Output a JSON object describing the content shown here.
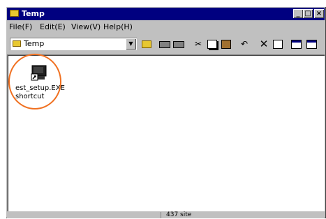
{
  "window": {
    "title": "Temp"
  },
  "menu": {
    "items": [
      {
        "label": "File(F)"
      },
      {
        "label": "Edit(E)"
      },
      {
        "label": "View(V)"
      },
      {
        "label": "Help(H)"
      }
    ]
  },
  "address": {
    "value": "Temp"
  },
  "toolbar": {
    "buttons": [
      {
        "icon": "up-folder-icon"
      },
      {
        "icon": "map-drive-icon"
      },
      {
        "icon": "disconnect-drive-icon"
      },
      {
        "icon": "cut-icon"
      },
      {
        "icon": "copy-icon"
      },
      {
        "icon": "paste-icon"
      },
      {
        "icon": "undo-icon"
      },
      {
        "icon": "delete-icon"
      },
      {
        "icon": "properties-icon"
      },
      {
        "icon": "large-icons-icon"
      },
      {
        "icon": "small-icons-icon"
      }
    ]
  },
  "files": [
    {
      "name_line1": "est_setup.EXE",
      "name_line2": "shortcut"
    }
  ],
  "status": {
    "size": "437 site"
  },
  "colors": {
    "titlebar": "#000080",
    "highlight_circle": "#f07020"
  }
}
